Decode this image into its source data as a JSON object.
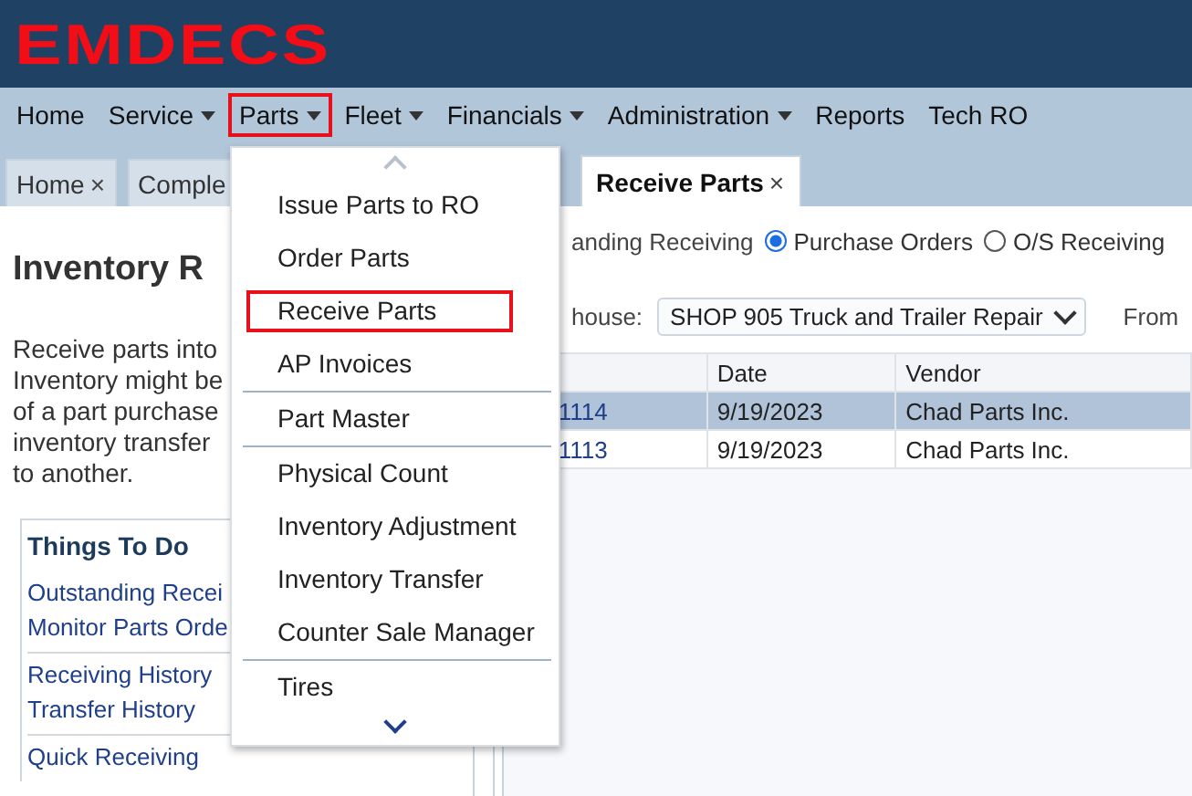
{
  "logo": "EMDECS",
  "nav": [
    {
      "label": "Home",
      "dropdown": false,
      "selected": false
    },
    {
      "label": "Service",
      "dropdown": true,
      "selected": false
    },
    {
      "label": "Parts",
      "dropdown": true,
      "selected": true
    },
    {
      "label": "Fleet",
      "dropdown": true,
      "selected": false
    },
    {
      "label": "Financials",
      "dropdown": true,
      "selected": false
    },
    {
      "label": "Administration",
      "dropdown": true,
      "selected": false
    },
    {
      "label": "Reports",
      "dropdown": false,
      "selected": false
    },
    {
      "label": "Tech RO",
      "dropdown": false,
      "selected": false
    }
  ],
  "tabs": [
    {
      "label": "Home",
      "close": "×",
      "selected": false
    },
    {
      "label": "Comple",
      "selected": false
    },
    {
      "label": "Receive Parts",
      "close": "×",
      "selected": true
    }
  ],
  "left_panel": {
    "title": "Inventory R",
    "description": [
      "Receive parts into",
      "Inventory might be",
      "of a part purchase",
      "inventory transfer",
      "to another."
    ],
    "things_to_do": {
      "title": "Things To Do",
      "groups": [
        [
          "Outstanding Recei",
          "Monitor Parts Orde"
        ],
        [
          "Receiving History",
          "Transfer History"
        ],
        [
          "Quick Receiving"
        ]
      ]
    }
  },
  "receiving": {
    "label": "anding Receiving",
    "options": [
      {
        "label": "Purchase Orders",
        "selected": true
      },
      {
        "label": "O/S Receiving",
        "selected": false
      }
    ]
  },
  "warehouse": {
    "label": "house:",
    "value": "SHOP 905 Truck and Trailer Repair",
    "from_label": "From"
  },
  "table": {
    "columns": [
      "",
      "Date",
      "Vendor"
    ],
    "rows": [
      {
        "cells": [
          "1114",
          "9/19/2023",
          "Chad Parts Inc."
        ],
        "selected": true
      },
      {
        "cells": [
          "1113",
          "9/19/2023",
          "Chad Parts Inc."
        ],
        "selected": false
      }
    ]
  },
  "menu": {
    "groups": [
      [
        {
          "label": "Issue Parts to RO",
          "selected": false
        },
        {
          "label": "Order Parts",
          "selected": false
        },
        {
          "label": "Receive Parts",
          "selected": true
        },
        {
          "label": "AP Invoices",
          "selected": false
        }
      ],
      [
        {
          "label": "Part Master",
          "selected": false
        }
      ],
      [
        {
          "label": "Physical Count",
          "selected": false
        },
        {
          "label": "Inventory Adjustment",
          "selected": false
        },
        {
          "label": "Inventory Transfer",
          "selected": false
        },
        {
          "label": "Counter Sale Manager",
          "selected": false
        }
      ],
      [
        {
          "label": "Tires",
          "selected": false
        }
      ]
    ]
  }
}
